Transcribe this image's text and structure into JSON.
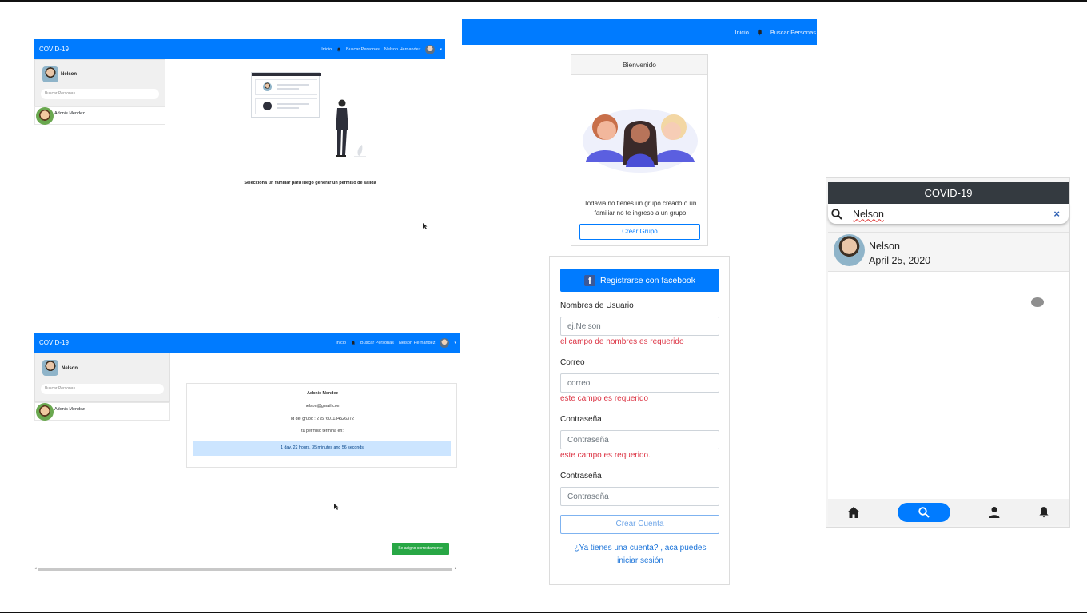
{
  "panel1": {
    "brand": "COVID-19",
    "nav": {
      "home": "Inicio",
      "search": "Buscar Personas",
      "user": "Nelson Hernandez"
    },
    "profile_name": "Nelson",
    "search_placeholder": "Buscar Personas",
    "contact": "Adonis Mendez",
    "caption": "Selecciona un familiar para luego generar un permiso de salida"
  },
  "panel2": {
    "brand": "COVID-19",
    "nav": {
      "home": "Inicio",
      "search": "Buscar Personas",
      "user": "Nelson Hernandez"
    },
    "profile_name": "Nelson",
    "search_placeholder": "Buscar Personas",
    "contact": "Adonis Mendez",
    "detail": {
      "name": "Adonis Mendez",
      "email": "nelson@gmail.com",
      "group_id": "id del grupo : 2757601134526372",
      "ends_label": "tu permiso termina en:",
      "countdown": "1 day, 22 hours, 35 minutes and 56 seconds"
    },
    "toast": "Se asigno correctamente"
  },
  "panel3": {
    "nav": {
      "home": "Inicio",
      "search": "Buscar Personas"
    },
    "header": "Bienvenido",
    "message_line1": "Todavia no tienes un grupo creado o un",
    "message_line2": "familiar no te ingreso a un grupo",
    "button": "Crear Grupo"
  },
  "panel4": {
    "facebook_button": "Registrarse con facebook",
    "facebook_glyph": "f",
    "fields": [
      {
        "label": "Nombres de Usuario",
        "placeholder": "ej.Nelson",
        "error": "el campo de nombres es requerido"
      },
      {
        "label": "Correo",
        "placeholder": "correo",
        "error": "este campo es requerido"
      },
      {
        "label": "Contraseña",
        "placeholder": "Contraseña",
        "error": "este campo es requerido."
      },
      {
        "label": "Contraseña",
        "placeholder": "Contraseña",
        "error": ""
      }
    ],
    "submit": "Crear Cuenta",
    "login_line1": "¿Ya tienes una cuenta? , aca puedes",
    "login_line2": "iniciar sesión"
  },
  "panel5": {
    "title": "COVID-19",
    "search_value": "Nelson",
    "result": {
      "name": "Nelson",
      "date": "April 25, 2020"
    },
    "icons": [
      "home-icon",
      "search-icon",
      "person-icon",
      "bell-icon"
    ]
  },
  "colors": {
    "primary": "#007bff",
    "danger": "#dc3545",
    "success": "#28a745",
    "dark": "#343a40"
  }
}
